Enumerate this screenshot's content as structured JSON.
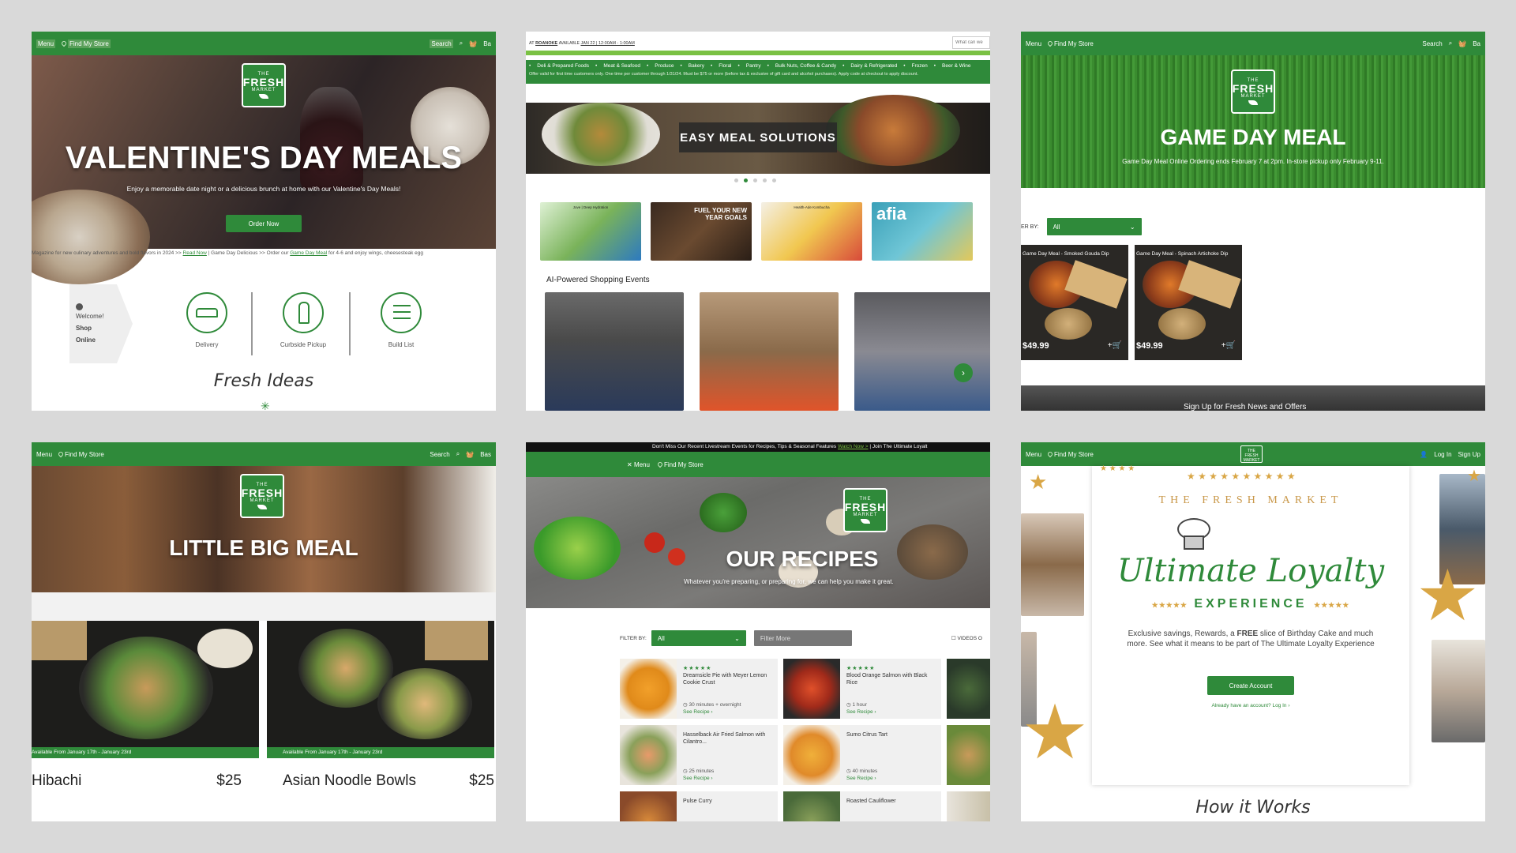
{
  "panels": {
    "valentines": {
      "menu": "Menu",
      "find_store": "Find My Store",
      "search": "Search",
      "basket": "Ba",
      "logo": {
        "the": "THE",
        "fresh": "FRESH",
        "market": "MARKET"
      },
      "title": "VALENTINE'S DAY MEALS",
      "subtitle": "Enjoy a memorable date night or a delicious brunch at home with our Valentine's Day Meals!",
      "cta": "Order Now",
      "marquee_1": "Magazine for new culinary adventures and bold flavors in 2024 >> ",
      "marquee_link1": "Read Now",
      "marquee_2": " | Game Day Delicious >> Order our ",
      "marquee_link2": "Game Day Meal",
      "marquee_3": " for 4-6 and enjoy wings, cheesesteak egg",
      "welcome": {
        "line1": "Welcome!",
        "line2": "Shop",
        "line3": "Online"
      },
      "services": [
        "Delivery",
        "Curbside Pickup",
        "Build List"
      ],
      "section_title": "Fresh Ideas"
    },
    "shop": {
      "at": "AT",
      "store": "ROANOKE",
      "available": "AVAILABLE",
      "slot": "JAN 22 | 12:00AM - 1:00AM",
      "search_placeholder": "What can we",
      "categories": [
        "Deli & Prepared Foods",
        "Meat & Seafood",
        "Produce",
        "Bakery",
        "Floral",
        "Pantry",
        "Bulk Nuts, Coffee & Candy",
        "Dairy & Refrigerated",
        "Frozen",
        "Beer & Wine"
      ],
      "offer": "Offer valid for first time customers only. One time per customer through 1/31/24. Must be $75 or more (before tax & exclusive of gift card and alcohol purchases). Apply code at checkout to apply discount.",
      "banner": "EASY MEAL SOLUTIONS",
      "tiles": [
        "Jove | Deep Hydration",
        "FUEL YOUR NEW YEAR GOALS",
        "Health-Ade Kombucha",
        "afia"
      ],
      "ai_title": "AI-Powered Shopping Events",
      "next": "›"
    },
    "gameday": {
      "menu": "Menu",
      "find_store": "Find My Store",
      "search": "Search",
      "basket": "Ba",
      "title": "GAME DAY MEAL",
      "subtitle": "Game Day Meal Online Ordering ends February 7 at 2pm. In-store pickup only February 9-11.",
      "filter_label": "ER BY:",
      "filter_value": "All",
      "products": [
        {
          "name": "Game Day Meal - Smoked Gouda Dip",
          "price": "$49.99"
        },
        {
          "name": "Game Day Meal - Spinach Artichoke Dip",
          "price": "$49.99"
        }
      ],
      "signup": "Sign Up for Fresh News and Offers"
    },
    "littlebig": {
      "menu": "Menu",
      "find_store": "Find My Store",
      "search": "Search",
      "basket": "Bas",
      "title": "LITTLE BIG MEAL",
      "meals": [
        {
          "avail": "Available From January 17th - January 23rd",
          "name": "Hibachi",
          "price": "$25"
        },
        {
          "avail": "Available From January 17th - January 23rd",
          "name": "Asian Noodle Bowls",
          "price": "$25"
        }
      ]
    },
    "recipes": {
      "announcement": "Don't Miss Our Recent Livestream Events for Recipes, Tips & Seasonal Features ",
      "announcement_link": "Watch Now >",
      "announcement_2": "   |   Join The Ultimate Loyalt",
      "menu": "Menu",
      "find_store": "Find My Store",
      "title": "OUR RECIPES",
      "subtitle": "Whatever you're preparing, or preparing for, we can help you make it great.",
      "filter_label": "FILTER BY:",
      "filter_value": "All",
      "filter_more": "Filter More",
      "videos": "VIDEOS O",
      "cards": [
        {
          "name": "Dreamsicle Pie with Meyer Lemon Cookie Crust",
          "time": "30 minutes + overnight",
          "see": "See Recipe ›",
          "stars": "★★★★★"
        },
        {
          "name": "Blood Orange Salmon with Black Rice",
          "time": "1 hour",
          "see": "See Recipe ›",
          "stars": "★★★★★"
        },
        {
          "name": "Hasselback Air Fried Salmon with Cilantro...",
          "time": "25 minutes",
          "see": "See Recipe ›",
          "stars": ""
        },
        {
          "name": "Sumo Citrus Tart",
          "time": "40 minutes",
          "see": "See Recipe ›",
          "stars": ""
        },
        {
          "name": "Pulse Curry",
          "time": "",
          "see": "",
          "stars": ""
        },
        {
          "name": "Roasted Cauliflower",
          "time": "",
          "see": "",
          "stars": ""
        }
      ]
    },
    "loyalty": {
      "menu": "Menu",
      "find_store": "Find My Store",
      "login": "Log In",
      "signup": "Sign Up",
      "arc": "THE FRESH MARKET",
      "script": "Ultimate Loyalty",
      "experience": "EXPERIENCE",
      "desc_1": "Exclusive savings, Rewards, a ",
      "desc_free": "FREE",
      "desc_2": " slice of Birthday Cake and much more. See what it means to be part of The Ultimate Loyalty Experience",
      "cta": "Create Account",
      "already": "Already have an account? Log In ›",
      "how": "How it Works"
    }
  },
  "colors": {
    "brand_green": "#2f8a3a",
    "light_green": "#7ac143",
    "gold": "#d9a645"
  }
}
